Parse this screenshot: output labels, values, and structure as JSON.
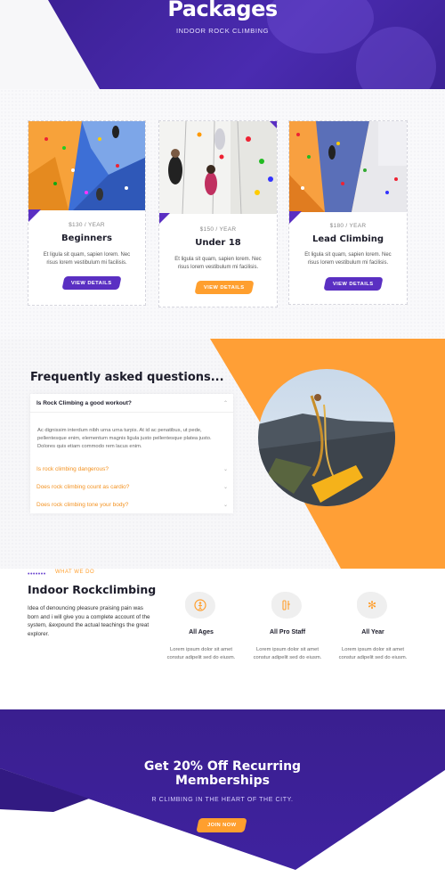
{
  "hero": {
    "title": "Packages",
    "subtitle": "INDOOR ROCK CLIMBING"
  },
  "packages": [
    {
      "price": "$130 / YEAR",
      "title": "Beginners",
      "description": "Et ligula sit quam, sapien lorem. Nec risus lorem vestibulum mi facilisis.",
      "button_label": "VIEW DETAILS",
      "button_color": "#5a2fc2"
    },
    {
      "price": "$150 / YEAR",
      "title": "Under 18",
      "description": "Et ligula sit quam, sapien lorem. Nec risus lorem vestibulum mi facilisis.",
      "button_label": "VIEW DETAILS",
      "button_color": "#ff9f2e"
    },
    {
      "price": "$180 / YEAR",
      "title": "Lead Climbing",
      "description": "Et ligula sit quam, sapien lorem. Nec risus lorem vestibulum mi facilisis.",
      "button_label": "VIEW DETAILS",
      "button_color": "#5a2fc2"
    }
  ],
  "faq": {
    "title": "Frequently asked questions...",
    "items": [
      {
        "question": "Is Rock Climbing a good workout?",
        "expanded": true,
        "answer": "Ac dignissim interdum nibh urna urna turpis. At id ac penatibus, ut pede, pellentesque enim, elementum magnis ligula justo pellentesque platea justo. Dolores quis etiam commodo rem lacus enim."
      },
      {
        "question": "Is rock climbing dangerous?",
        "expanded": false
      },
      {
        "question": "Does rock climbing count as cardio?",
        "expanded": false
      },
      {
        "question": "Does rock climbing tone your body?",
        "expanded": false
      }
    ]
  },
  "what_we_do": {
    "label": "WHAT WE DO",
    "title": "Indoor Rockclimbing",
    "text": "Idea of denouncing pleasure praising pain was born and i will give you a complete account of the system, &expound the actual teachings the great explorer.",
    "features": [
      {
        "icon": "climber-icon",
        "title": "All Ages",
        "description": "Lorem ipsum dolor sit amet constur adipelit sed do eiusm."
      },
      {
        "icon": "staff-icon",
        "title": "All Pro Staff",
        "description": "Lorem ipsum dolor sit amet constur adipelit sed do eiusm."
      },
      {
        "icon": "snowflake-icon",
        "title": "All Year",
        "description": "Lorem ipsum dolor sit amet constur adipelit sed do eiusm."
      }
    ]
  },
  "cta": {
    "title_line1": "Get 20% Off Recurring",
    "title_line2": "Memberships",
    "subtitle": "R CLIMBING IN THE HEART OF THE CITY.",
    "button_label": "JOIN NOW"
  },
  "colors": {
    "primary_purple": "#3f22a0",
    "accent_orange": "#ff9f2e",
    "button_purple": "#5a2fc2"
  }
}
